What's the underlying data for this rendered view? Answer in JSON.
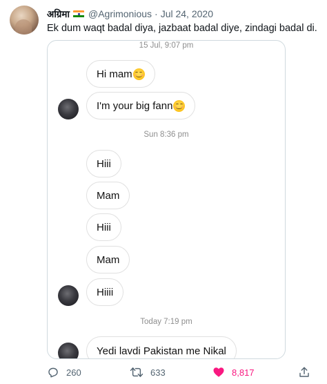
{
  "tweet": {
    "display_name": "अग्रिमा",
    "handle": "@Agrimonious",
    "separator": "·",
    "date": "Jul 24, 2020",
    "text": "Ek dum waqt badal diya, jazbaat badal diye, zindagi badal di."
  },
  "chat": {
    "stamps": [
      "15 Jul, 9:07 pm",
      "Sun 8:36 pm",
      "Today 7:19 pm"
    ],
    "messages": [
      {
        "text": "Hi mam",
        "emoji": "smiling-face-icon"
      },
      {
        "text": "I'm your big fann",
        "emoji": "smiling-face-icon"
      },
      {
        "text": "Hiii"
      },
      {
        "text": "Mam"
      },
      {
        "text": "Hiii"
      },
      {
        "text": "Mam"
      },
      {
        "text": "Hiiii"
      },
      {
        "text": "Yedi lavdi Pakistan me Nikal"
      }
    ]
  },
  "actions": {
    "replies": "260",
    "retweets": "633",
    "likes": "8,817",
    "like_color": "#f91880",
    "icons": [
      "reply-icon",
      "retweet-icon",
      "heart-icon",
      "share-icon"
    ]
  }
}
